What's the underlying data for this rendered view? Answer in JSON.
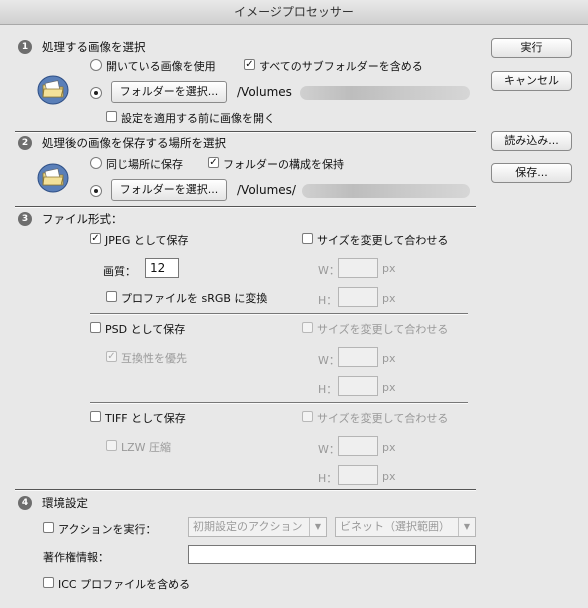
{
  "window": {
    "title": "イメージプロセッサー"
  },
  "buttons": {
    "run": "実行",
    "cancel": "キャンセル",
    "load": "読み込み...",
    "save": "保存..."
  },
  "section1": {
    "number": "1",
    "title": "処理する画像を選択",
    "use_open_images": "開いている画像を使用",
    "include_subfolders": "すべてのサブフォルダーを含める",
    "select_folder_button": "フォルダーを選択...",
    "path": "/Volumes",
    "open_first_image": "設定を適用する前に画像を開く"
  },
  "section2": {
    "number": "2",
    "title": "処理後の画像を保存する場所を選択",
    "same_location": "同じ場所に保存",
    "keep_structure": "フォルダーの構成を保持",
    "select_folder_button": "フォルダーを選択...",
    "path": "/Volumes/"
  },
  "section3": {
    "number": "3",
    "title": "ファイル形式：",
    "jpeg": {
      "save_as": "JPEG として保存",
      "resize": "サイズを変更して合わせる",
      "quality_label": "画質：",
      "quality_value": "12",
      "srgb": "プロファイルを sRGB に変換"
    },
    "psd": {
      "save_as": "PSD として保存",
      "resize": "サイズを変更して合わせる",
      "compat": "互換性を優先"
    },
    "tiff": {
      "save_as": "TIFF として保存",
      "resize": "サイズを変更して合わせる",
      "lzw": "LZW 圧縮"
    },
    "w_label": "W：",
    "h_label": "H：",
    "unit": "px"
  },
  "section4": {
    "number": "4",
    "title": "環境設定",
    "run_action": "アクションを実行：",
    "action_set": "初期設定のアクション",
    "action": "ビネット（選択範囲）",
    "copyright": "著作権情報：",
    "include_icc": "ICC プロファイルを含める"
  },
  "colors": {
    "background": "#e8e8e8",
    "badge": "#6e6e6e",
    "disabled_text": "#999999"
  }
}
